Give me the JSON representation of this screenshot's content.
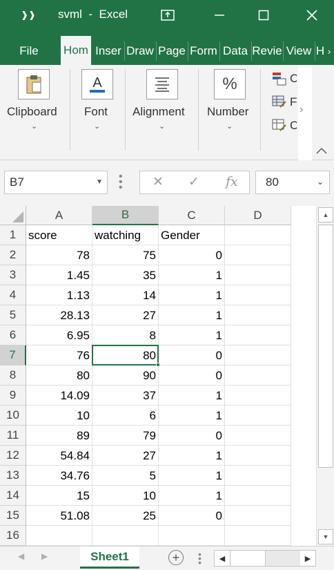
{
  "window": {
    "title": "svml  -  Excel",
    "controls": {
      "minimize": "minimize-icon",
      "maximize": "maximize-icon",
      "close": "close-icon"
    }
  },
  "tabs": [
    {
      "label": "File",
      "active": false
    },
    {
      "label": "Hom",
      "active": true
    },
    {
      "label": "Inser",
      "active": false
    },
    {
      "label": "Draw",
      "active": false
    },
    {
      "label": "Page",
      "active": false
    },
    {
      "label": "Form",
      "active": false
    },
    {
      "label": "Data",
      "active": false
    },
    {
      "label": "Revie",
      "active": false
    },
    {
      "label": "View",
      "active": false
    },
    {
      "label": "H",
      "active": false
    }
  ],
  "ribbon": {
    "groups": [
      {
        "label": "Clipboard",
        "icon": "clipboard-icon"
      },
      {
        "label": "Font",
        "icon": "font-color-icon"
      },
      {
        "label": "Alignment",
        "icon": "align-icon"
      },
      {
        "label": "Number",
        "icon": "percent-icon",
        "glyph": "%"
      }
    ],
    "styles_items": [
      "C",
      "F",
      "C"
    ]
  },
  "formula_bar": {
    "name_box": "B7",
    "value": "80"
  },
  "grid": {
    "columns": [
      "A",
      "B",
      "C",
      "D"
    ],
    "selected_column": "B",
    "selected_row": 7,
    "rows": [
      {
        "row": "1",
        "A": "score",
        "B": "watching",
        "C": "Gender",
        "D": ""
      },
      {
        "row": "2",
        "A": "78",
        "B": "75",
        "C": "0",
        "D": ""
      },
      {
        "row": "3",
        "A": "1.45",
        "B": "35",
        "C": "1",
        "D": ""
      },
      {
        "row": "4",
        "A": "1.13",
        "B": "14",
        "C": "1",
        "D": ""
      },
      {
        "row": "5",
        "A": "28.13",
        "B": "27",
        "C": "1",
        "D": ""
      },
      {
        "row": "6",
        "A": "6.95",
        "B": "8",
        "C": "1",
        "D": ""
      },
      {
        "row": "7",
        "A": "76",
        "B": "80",
        "C": "0",
        "D": ""
      },
      {
        "row": "8",
        "A": "80",
        "B": "90",
        "C": "0",
        "D": ""
      },
      {
        "row": "9",
        "A": "14.09",
        "B": "37",
        "C": "1",
        "D": ""
      },
      {
        "row": "10",
        "A": "10",
        "B": "6",
        "C": "1",
        "D": ""
      },
      {
        "row": "11",
        "A": "89",
        "B": "79",
        "C": "0",
        "D": ""
      },
      {
        "row": "12",
        "A": "54.84",
        "B": "27",
        "C": "1",
        "D": ""
      },
      {
        "row": "13",
        "A": "34.76",
        "B": "5",
        "C": "1",
        "D": ""
      },
      {
        "row": "14",
        "A": "15",
        "B": "10",
        "C": "1",
        "D": ""
      },
      {
        "row": "15",
        "A": "51.08",
        "B": "25",
        "C": "0",
        "D": ""
      },
      {
        "row": "16",
        "A": "",
        "B": "",
        "C": "",
        "D": ""
      }
    ]
  },
  "sheets": [
    {
      "label": "Sheet1",
      "active": true
    }
  ],
  "colors": {
    "accent": "#217346",
    "ribbon_bg": "#f3f3f3",
    "header_selected": "#d2d2d2"
  }
}
